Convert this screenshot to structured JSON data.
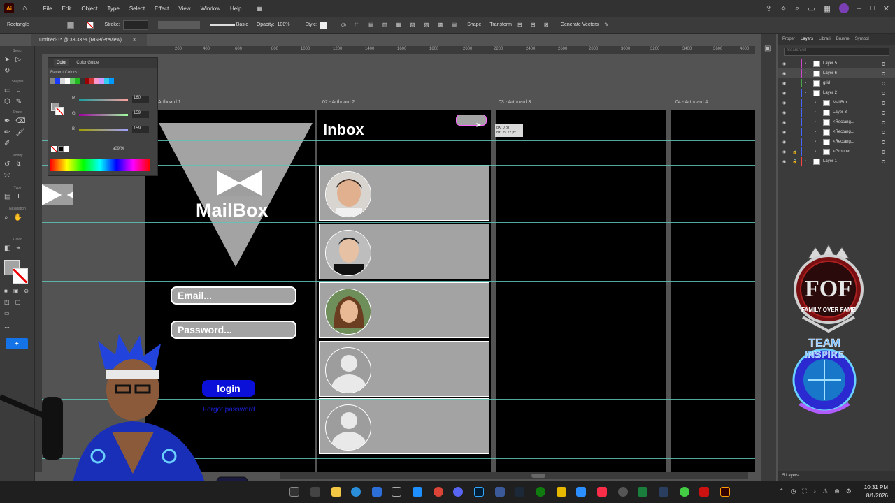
{
  "menu": {
    "logo": "Ai",
    "items": [
      "File",
      "Edit",
      "Object",
      "Type",
      "Select",
      "Effect",
      "View",
      "Window",
      "Help"
    ]
  },
  "control": {
    "selection": "Rectangle",
    "stroke_label": "Stroke:",
    "profile": "Basic",
    "opacity_label": "Opacity:",
    "opacity_value": "100%",
    "style_label": "Style:",
    "shape_label": "Shape:",
    "transform_label": "Transform",
    "generate_label": "Generate Vectors"
  },
  "document": {
    "tab_title": "Untitled-1* @ 33.33 % (RGB/Preview)",
    "close": "×"
  },
  "toolbar": {
    "sections": [
      "Select",
      "Shapes",
      "Draw",
      "Modify",
      "Type",
      "Navigation",
      "Color"
    ],
    "type_tool": "T"
  },
  "rulers": {
    "ticks": [
      "200",
      "400",
      "600",
      "800",
      "1000",
      "1200",
      "1400",
      "1600",
      "1800",
      "2000",
      "2200",
      "2400",
      "2600",
      "2800",
      "3000",
      "3200",
      "3400",
      "3600",
      "3800",
      "4000"
    ]
  },
  "artboards": [
    "Artboard 1",
    "02 - Artboard 2",
    "03 - Artboard 3",
    "04 - Artboard 4"
  ],
  "login": {
    "app_name": "MailBox",
    "email_placeholder": "Email...",
    "password_placeholder": "Password...",
    "login_label": "login",
    "forgot_label": "Forgot password"
  },
  "inbox": {
    "title": "Inbox",
    "rows": 5
  },
  "drag_tooltip": {
    "dx": "dX: 0 px",
    "dy": "dY: 29.22 px"
  },
  "color_panel": {
    "tab_active": "Color",
    "tab_other": "Color Guide",
    "recent_label": "Recent Colors",
    "recent_colors": [
      "#888888",
      "#1a3cff",
      "#d9d9d9",
      "#ffffff",
      "#66cc66",
      "#22bb22",
      "#333333",
      "#990000",
      "#cc3333",
      "#ff99cc",
      "#cc99ff",
      "#33ccee",
      "#0099ff"
    ],
    "r_label": "R",
    "r_value": "160",
    "g_label": "G",
    "g_value": "159",
    "b_label": "B",
    "b_value": "159",
    "hex": "a09f9f"
  },
  "layers_panel": {
    "tabs": [
      "Proper",
      "Layers",
      "Librari",
      "Brushe",
      "Symbol"
    ],
    "active_tab": "Layers",
    "search_placeholder": "Search All",
    "layers": [
      {
        "name": "Layer 5",
        "color": "#cc44cc",
        "indent": 0
      },
      {
        "name": "Layer 6",
        "color": "#cc44cc",
        "indent": 0
      },
      {
        "name": "grid",
        "color": "#44aa44",
        "indent": 0
      },
      {
        "name": "Layer 2",
        "color": "#4466ff",
        "indent": 0
      },
      {
        "name": "MailBox",
        "color": "#4466ff",
        "indent": 1
      },
      {
        "name": "Layer 3",
        "color": "#4466ff",
        "indent": 1
      },
      {
        "name": "<Rectang...",
        "color": "#4466ff",
        "indent": 1
      },
      {
        "name": "<Rectang...",
        "color": "#4466ff",
        "indent": 1
      },
      {
        "name": "<Rectang...",
        "color": "#4466ff",
        "indent": 1
      },
      {
        "name": "<Group>",
        "color": "#4466ff",
        "indent": 1
      },
      {
        "name": "Layer 1",
        "color": "#ff4444",
        "indent": 0
      }
    ],
    "footer": "5 Layers"
  },
  "logos": {
    "fof_big": "FOF",
    "fof_caption": "FAMILY OVER FAME",
    "team_line1": "TEAM",
    "team_line2": "INSPIRE"
  },
  "taskbar": {
    "time": "10:31 PM",
    "date": "8/1/2026"
  }
}
